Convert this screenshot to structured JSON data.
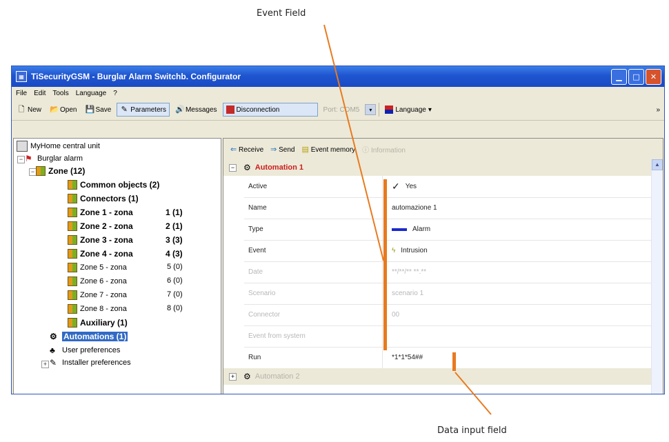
{
  "callouts": {
    "event_field": "Event Field",
    "data_input_field": "Data input field"
  },
  "window": {
    "title": "TiSecurityGSM - Burglar Alarm Switchb. Configurator"
  },
  "menu": [
    "File",
    "Edit",
    "Tools",
    "Language",
    "?"
  ],
  "toolbar": {
    "new": "New",
    "open": "Open",
    "save": "Save",
    "parameters": "Parameters",
    "messages": "Messages",
    "disconnection": "Disconnection",
    "port": "Port: COM5",
    "language": "Language",
    "overflow": "»"
  },
  "tree": {
    "root": "MyHome central unit",
    "burglar": "Burglar alarm",
    "zone": "Zone (12)",
    "items": [
      {
        "label": "Common objects (2)",
        "count": ""
      },
      {
        "label": "Connectors (1)",
        "count": ""
      },
      {
        "label": "Zone 1 - zona",
        "count": "1 (1)"
      },
      {
        "label": "Zone 2 - zona",
        "count": "2 (1)"
      },
      {
        "label": "Zone 3 - zona",
        "count": "3 (3)"
      },
      {
        "label": "Zone 4 - zona",
        "count": "4 (3)"
      },
      {
        "label": "Zone 5 - zona",
        "count": "5 (0)"
      },
      {
        "label": "Zone 6 - zona",
        "count": "6 (0)"
      },
      {
        "label": "Zone 7 - zona",
        "count": "7 (0)"
      },
      {
        "label": "Zone 8 - zona",
        "count": "8 (0)"
      },
      {
        "label": "Auxiliary (1)",
        "count": ""
      }
    ],
    "automations": "Automations (1)",
    "user_pref": "User preferences",
    "installer_pref": "Installer preferences"
  },
  "actions": {
    "receive": "Receive",
    "send": "Send",
    "event_memory": "Event memory",
    "information": "Information"
  },
  "automation1": {
    "title": "Automation 1",
    "rows": [
      {
        "label": "Active",
        "value": "Yes"
      },
      {
        "label": "Name",
        "value": "automazione 1"
      },
      {
        "label": "Type",
        "value": "Alarm"
      },
      {
        "label": "Event",
        "value": "Intrusion"
      },
      {
        "label": "Date",
        "value": "**/**/** **.**"
      },
      {
        "label": "Scenario",
        "value": "scenario  1"
      },
      {
        "label": "Connector",
        "value": "00"
      },
      {
        "label": "Event from system",
        "value": ""
      },
      {
        "label": "Run",
        "value": "*1*1*54##"
      }
    ]
  },
  "automation2": {
    "title": "Automation 2"
  },
  "colors": {
    "highlight": "#e87a1f",
    "title_red": "#cc1d1d",
    "selection": "#316ac5"
  }
}
